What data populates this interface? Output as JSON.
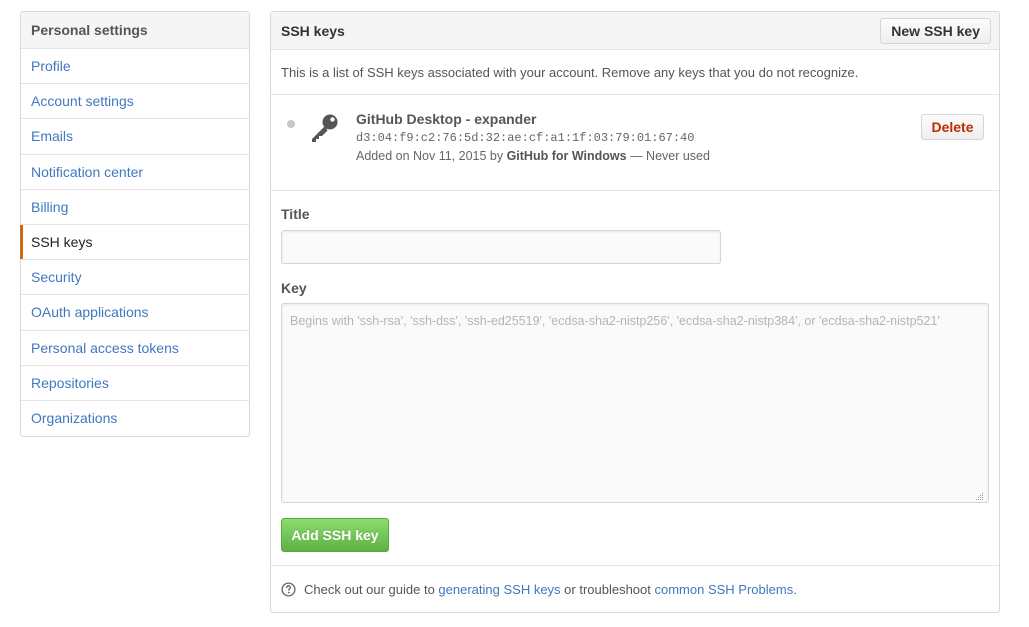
{
  "sidebar": {
    "header": "Personal settings",
    "items": [
      {
        "label": "Profile"
      },
      {
        "label": "Account settings"
      },
      {
        "label": "Emails"
      },
      {
        "label": "Notification center"
      },
      {
        "label": "Billing"
      },
      {
        "label": "SSH keys",
        "selected": true
      },
      {
        "label": "Security"
      },
      {
        "label": "OAuth applications"
      },
      {
        "label": "Personal access tokens"
      },
      {
        "label": "Repositories"
      },
      {
        "label": "Organizations"
      }
    ],
    "accent_color": "#d26911",
    "link_color": "#4078c0"
  },
  "panel": {
    "title": "SSH keys",
    "new_button": "New SSH key",
    "description": "This is a list of SSH keys associated with your account. Remove any keys that you do not recognize.",
    "key": {
      "icon": "key-icon",
      "title": "GitHub Desktop - expander",
      "fingerprint": "d3:04:f9:c2:76:5d:32:ae:cf:a1:1f:03:79:01:67:40",
      "added_prefix": "Added on Nov 11, 2015 by ",
      "added_by": "GitHub for Windows",
      "usage": " — Never used",
      "delete_button": "Delete"
    },
    "form": {
      "title_label": "Title",
      "title_value": "",
      "key_label": "Key",
      "key_placeholder": "Begins with 'ssh-rsa', 'ssh-dss', 'ssh-ed25519', 'ecdsa-sha2-nistp256', 'ecdsa-sha2-nistp384', or 'ecdsa-sha2-nistp521'",
      "submit_button": "Add SSH key",
      "submit_color": "#60b044"
    },
    "help": {
      "icon": "question-circle-icon",
      "prefix": "Check out our guide to ",
      "link1": "generating SSH keys",
      "middle": " or troubleshoot ",
      "link2": "common SSH Problems",
      "suffix": "."
    },
    "danger_color": "#bd2c00"
  }
}
